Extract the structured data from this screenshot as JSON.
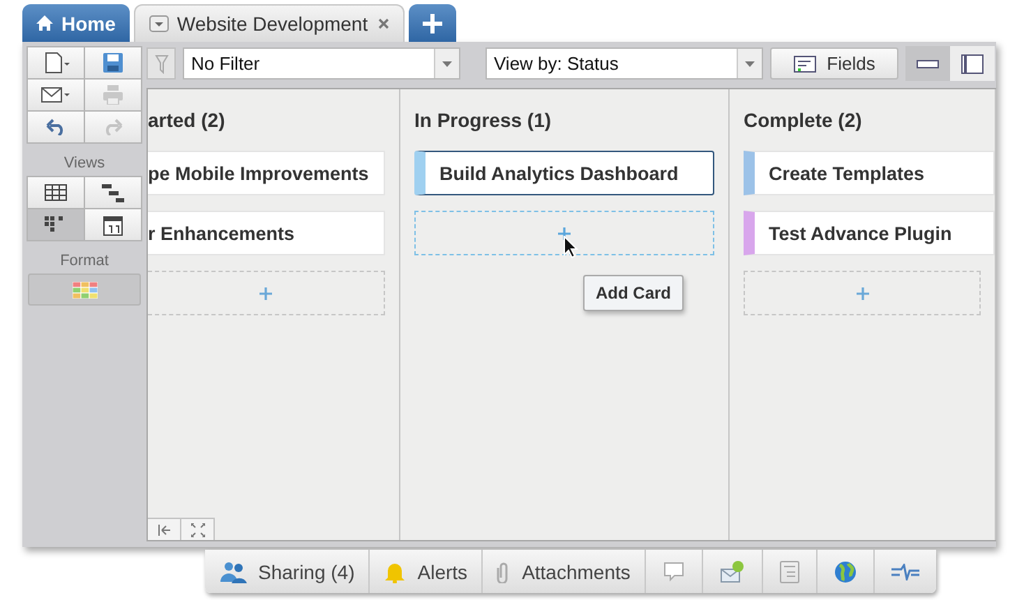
{
  "tabs": [
    {
      "kind": "home",
      "label": "Home"
    },
    {
      "kind": "document",
      "label": "Website Development",
      "selected": true
    },
    {
      "kind": "add"
    }
  ],
  "sidebar": {
    "tools": [
      {
        "kind": "new",
        "disabled": false
      },
      {
        "kind": "save",
        "disabled": false
      },
      {
        "kind": "email",
        "disabled": false
      },
      {
        "kind": "print",
        "disabled": true
      },
      {
        "kind": "undo",
        "disabled": false
      },
      {
        "kind": "redo",
        "disabled": true
      }
    ],
    "views_label": "Views",
    "views": [
      {
        "kind": "grid",
        "selected": false
      },
      {
        "kind": "gantt",
        "selected": false
      },
      {
        "kind": "card",
        "selected": true
      },
      {
        "kind": "calendar",
        "selected": false
      }
    ],
    "format_label": "Format"
  },
  "toolbar": {
    "filter": {
      "value": "No Filter"
    },
    "view_by": {
      "value": "View by: Status"
    },
    "fields_button": {
      "label": "Fields"
    },
    "layouts": [
      {
        "kind": "compact",
        "selected": true
      },
      {
        "kind": "full",
        "selected": false
      }
    ]
  },
  "columns": [
    {
      "title": "arted (2)",
      "add_hovered": false,
      "cards": [
        {
          "title": "pe Mobile Improvements",
          "selected": false
        },
        {
          "title": "r Enhancements",
          "selected": false
        }
      ]
    },
    {
      "title": "In Progress (1)",
      "add_hovered": true,
      "tooltip": "Add Card",
      "cards": [
        {
          "title": "Build Analytics Dashboard",
          "selected": true,
          "color": "#9fd0f0"
        }
      ]
    },
    {
      "title": "Complete (2)",
      "add_hovered": false,
      "cards": [
        {
          "title": "Create Templates",
          "selected": false,
          "color": "#9cc2e8"
        },
        {
          "title": "Test Advance Plugin",
          "selected": false,
          "color": "#d8a6ec"
        }
      ]
    }
  ],
  "bottom_bar": [
    {
      "kind": "sharing",
      "label": "Sharing (4)"
    },
    {
      "kind": "alerts",
      "label": "Alerts"
    },
    {
      "kind": "attachments",
      "label": "Attachments"
    },
    {
      "kind": "comments"
    },
    {
      "kind": "mail"
    },
    {
      "kind": "form"
    },
    {
      "kind": "globe"
    },
    {
      "kind": "activity"
    }
  ]
}
